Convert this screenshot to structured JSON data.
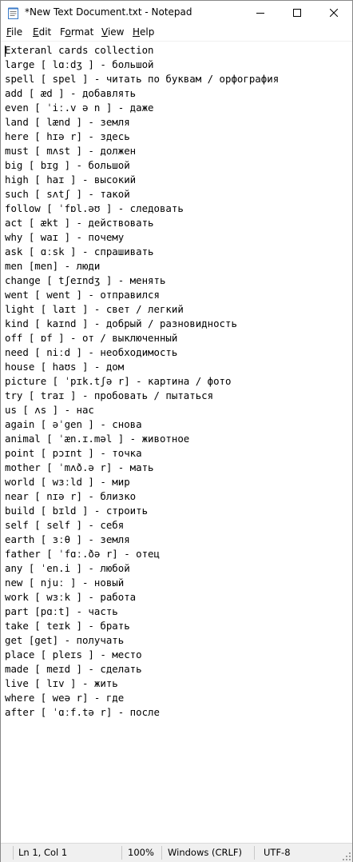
{
  "window": {
    "title": "*New Text Document.txt - Notepad"
  },
  "menu": {
    "file": {
      "hotkey": "F",
      "rest": "ile"
    },
    "edit": {
      "hotkey": "E",
      "rest": "dit"
    },
    "format": {
      "pre": "F",
      "hotkey": "o",
      "rest": "rmat"
    },
    "view": {
      "hotkey": "V",
      "rest": "iew"
    },
    "help": {
      "hotkey": "H",
      "rest": "elp"
    }
  },
  "editor": {
    "lines": [
      "Exteranl cards collection",
      "large [ lɑːdʒ ] - большой",
      "spell [ spel ] - читать по буквам / орфография",
      "add [ æd ] - добавлять",
      "even [ ˈiː.v ə n ] - даже",
      "land [ lænd ] - земля",
      "here [ hɪə r] - здесь",
      "must [ mʌst ] - должен",
      "big [ bɪg ] - большой",
      "high [ haɪ ] - высокий",
      "such [ sʌtʃ ] - такой",
      "follow [ ˈfɒl.əʊ ] - следовать",
      "act [ ækt ] - действовать",
      "why [ waɪ ] - почему",
      "ask [ ɑːsk ] - спрашивать",
      "men [men] - люди",
      "change [ tʃeɪndʒ ] - менять",
      "went [ went ] - отправился",
      "light [ laɪt ] - свет / легкий",
      "kind [ kaɪnd ] - добрый / разновидность",
      "off [ ɒf ] - от / выключенный",
      "need [ niːd ] - необходимость",
      "house [ haʊs ] - дом",
      "picture [ ˈpɪk.tʃə r] - картина / фото",
      "try [ traɪ ] - пробовать / пытаться",
      "us [ ʌs ] - нас",
      "again [ əˈgen ] - снова",
      "animal [ ˈæn.ɪ.məl ] - животное",
      "point [ pɔɪnt ] - точка",
      "mother [ ˈmʌð.ə r] - мать",
      "world [ wɜːld ] - мир",
      "near [ nɪə r] - близко",
      "build [ bɪld ] - строить",
      "self [ self ] - себя",
      "earth [ ɜːθ ] - земля",
      "father [ ˈfɑː.ðə r] - отец",
      "any [ ˈen.i ] - любой",
      "new [ njuː ] - новый",
      "work [ wɜːk ] - работа",
      "part [pɑːt] - часть",
      "take [ teɪk ] - брать",
      "get [get] - получать",
      "place [ pleɪs ] - место",
      "made [ meɪd ] - сделать",
      "live [ lɪv ] - жить",
      "where [ weə r] - где",
      "after [ ˈɑːf.tə r] - после"
    ]
  },
  "statusbar": {
    "position": "Ln 1, Col 1",
    "zoom": "100%",
    "line_ending": "Windows (CRLF)",
    "encoding": "UTF-8"
  },
  "colors": {
    "background": "#ffffff",
    "statusbar_bg": "#f0f0f0",
    "text": "#000000"
  }
}
